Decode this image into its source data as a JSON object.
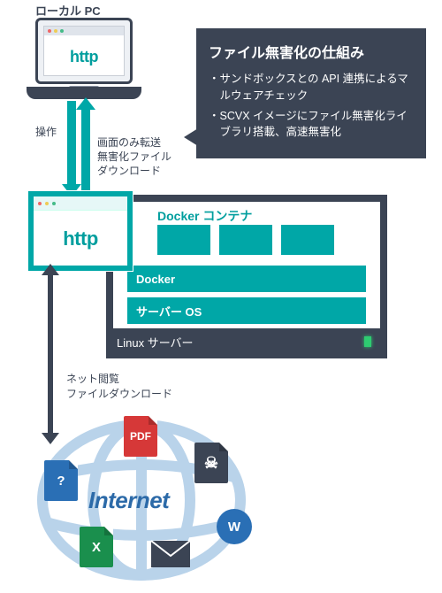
{
  "local_pc": {
    "label": "ローカル PC",
    "browser_text": "http"
  },
  "arrows": {
    "operate_label": "操作",
    "transfer_label": "画面のみ転送\n無害化ファイル\nダウンロード"
  },
  "container_window": {
    "browser_text": "http"
  },
  "server": {
    "docker_container_label": "Docker コンテナ",
    "layers": {
      "docker": "Docker",
      "os": "サーバー OS"
    },
    "footer": "Linux サーバー"
  },
  "callout": {
    "title": "ファイル無害化の仕組み",
    "bullets": [
      "・サンドボックスとの API 連携によるマルウェアチェック",
      "・SCVX イメージにファイル無害化ライブラリ搭載、高速無害化"
    ]
  },
  "net": {
    "label": "ネット閲覧\nファイルダウンロード"
  },
  "internet": {
    "label": "Internet",
    "icons": {
      "pdf": "PDF",
      "unknown": "?",
      "excel": "X",
      "word": "W"
    }
  }
}
